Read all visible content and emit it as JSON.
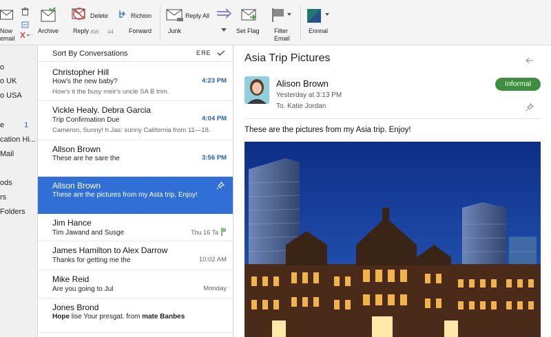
{
  "ribbon": {
    "new_email_line1": "Now",
    "new_email_line2": "email",
    "archive": "Archive",
    "delete": "Delete",
    "reply": "Reply",
    "reply_aw": "AW.",
    "reply_count": "44",
    "richion": "Richion",
    "forward": "Forward",
    "junk": "Junk",
    "reply_all": "Reply All",
    "set_flag": "Set Flag",
    "filter_line1": "Filter",
    "filter_line2": "Email",
    "ennnal": "Ennnal"
  },
  "folders": {
    "items": [
      "o",
      "o UK",
      "o USA",
      "e",
      "cation Hi...",
      "Mail",
      "ods",
      "rs",
      "Folders"
    ],
    "unread_count": "1"
  },
  "list": {
    "sort_label": "Sort By Conversations",
    "sort_icons": "ЕЯЕ",
    "messages": [
      {
        "from": "Christopher Hill",
        "subject": "How's the new baby?",
        "preview": "How's it the busy meir's uncle SA B trim.",
        "time": "4:23 PM"
      },
      {
        "from": "Vickle Healy. Debra Garcia",
        "subject": "Trip Confirmation Due",
        "preview": "Cameron, Sunny! h.Jas: sunny California from 11—18.",
        "time": "4:04 PM"
      },
      {
        "from": "Allson Brown",
        "subject": "These are he sare the",
        "time": "3:56 PM"
      },
      {
        "from": "Allson Brown",
        "subject": "These are the pictures from my Asta trip, Enjoy!"
      },
      {
        "from": "Jim Hance",
        "subject": "Tim Jawand and Susge",
        "time": "Thu 16 Ta"
      },
      {
        "from": "James Hamilton to Alex Darrow",
        "subject": "Thanks for getting me the",
        "time": "10:02 AM"
      },
      {
        "from": "Mike Reid",
        "subject": "Are you going to Jul",
        "time": "Monday"
      },
      {
        "from": "Jones Brond",
        "subject_bold1": "Hope",
        "subject_mid": "lise  Your presgat. from",
        "subject_bold2": "mate Banbes"
      }
    ]
  },
  "reading": {
    "title": "Asia Trip Pictures",
    "sender": "Alison Brown",
    "sent": "Yesterday at 3:13 PM",
    "to": "To. Katie Jordan",
    "badge": "Informal",
    "body": "These are the pictures from my Asia trip. Enjoy!"
  },
  "colors": {
    "accent_blue": "#2f6fd6",
    "time_blue": "#1f5fbf",
    "badge_green": "#3d8f3f",
    "ribbon_bg": "#f4f4f4"
  },
  "icons": [
    "new-email-icon",
    "trash-icon",
    "archive-icon",
    "delete-icon",
    "richion-icon",
    "junk-icon",
    "reply-all-icon",
    "set-flag-icon",
    "filter-icon",
    "ennnal-icon",
    "pin-icon",
    "back-arrow-icon",
    "flag-icon",
    "check-icon"
  ]
}
